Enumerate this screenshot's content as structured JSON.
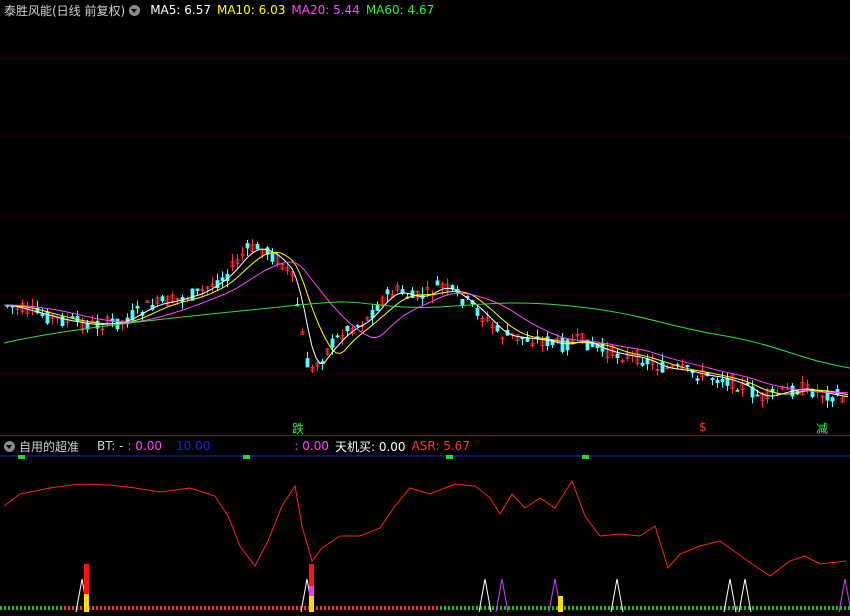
{
  "main": {
    "title": "泰胜风能(日线 前复权)",
    "indicators": [
      {
        "label": "MA5: ",
        "value": "6.57",
        "color": "#ffffff"
      },
      {
        "label": "MA10: ",
        "value": "6.03",
        "color": "#ffff00"
      },
      {
        "label": "MA20: ",
        "value": "5.44",
        "color": "#ff44ff"
      },
      {
        "label": "MA60: ",
        "value": "4.67",
        "color": "#33ee33"
      }
    ],
    "signals": [
      {
        "text": "跌",
        "color": "#33ee33"
      },
      {
        "text": "$",
        "color": "#ff3333"
      },
      {
        "text": "减",
        "color": "#33ee33"
      }
    ]
  },
  "sub": {
    "title": "自用的超准",
    "items": [
      {
        "text": "BT: -",
        "color": "#d0d0d0"
      },
      {
        "text": ": 0.00",
        "color": "#ff44ff"
      },
      {
        "text": "10.00",
        "color": "#2222dd"
      },
      {
        "text": ": 0.00",
        "color": "#ff44ff"
      },
      {
        "text": "天机买: 0.00",
        "color": "#ffffff"
      },
      {
        "text": "ASR: 5.67",
        "color": "#ff3333"
      }
    ]
  }
}
